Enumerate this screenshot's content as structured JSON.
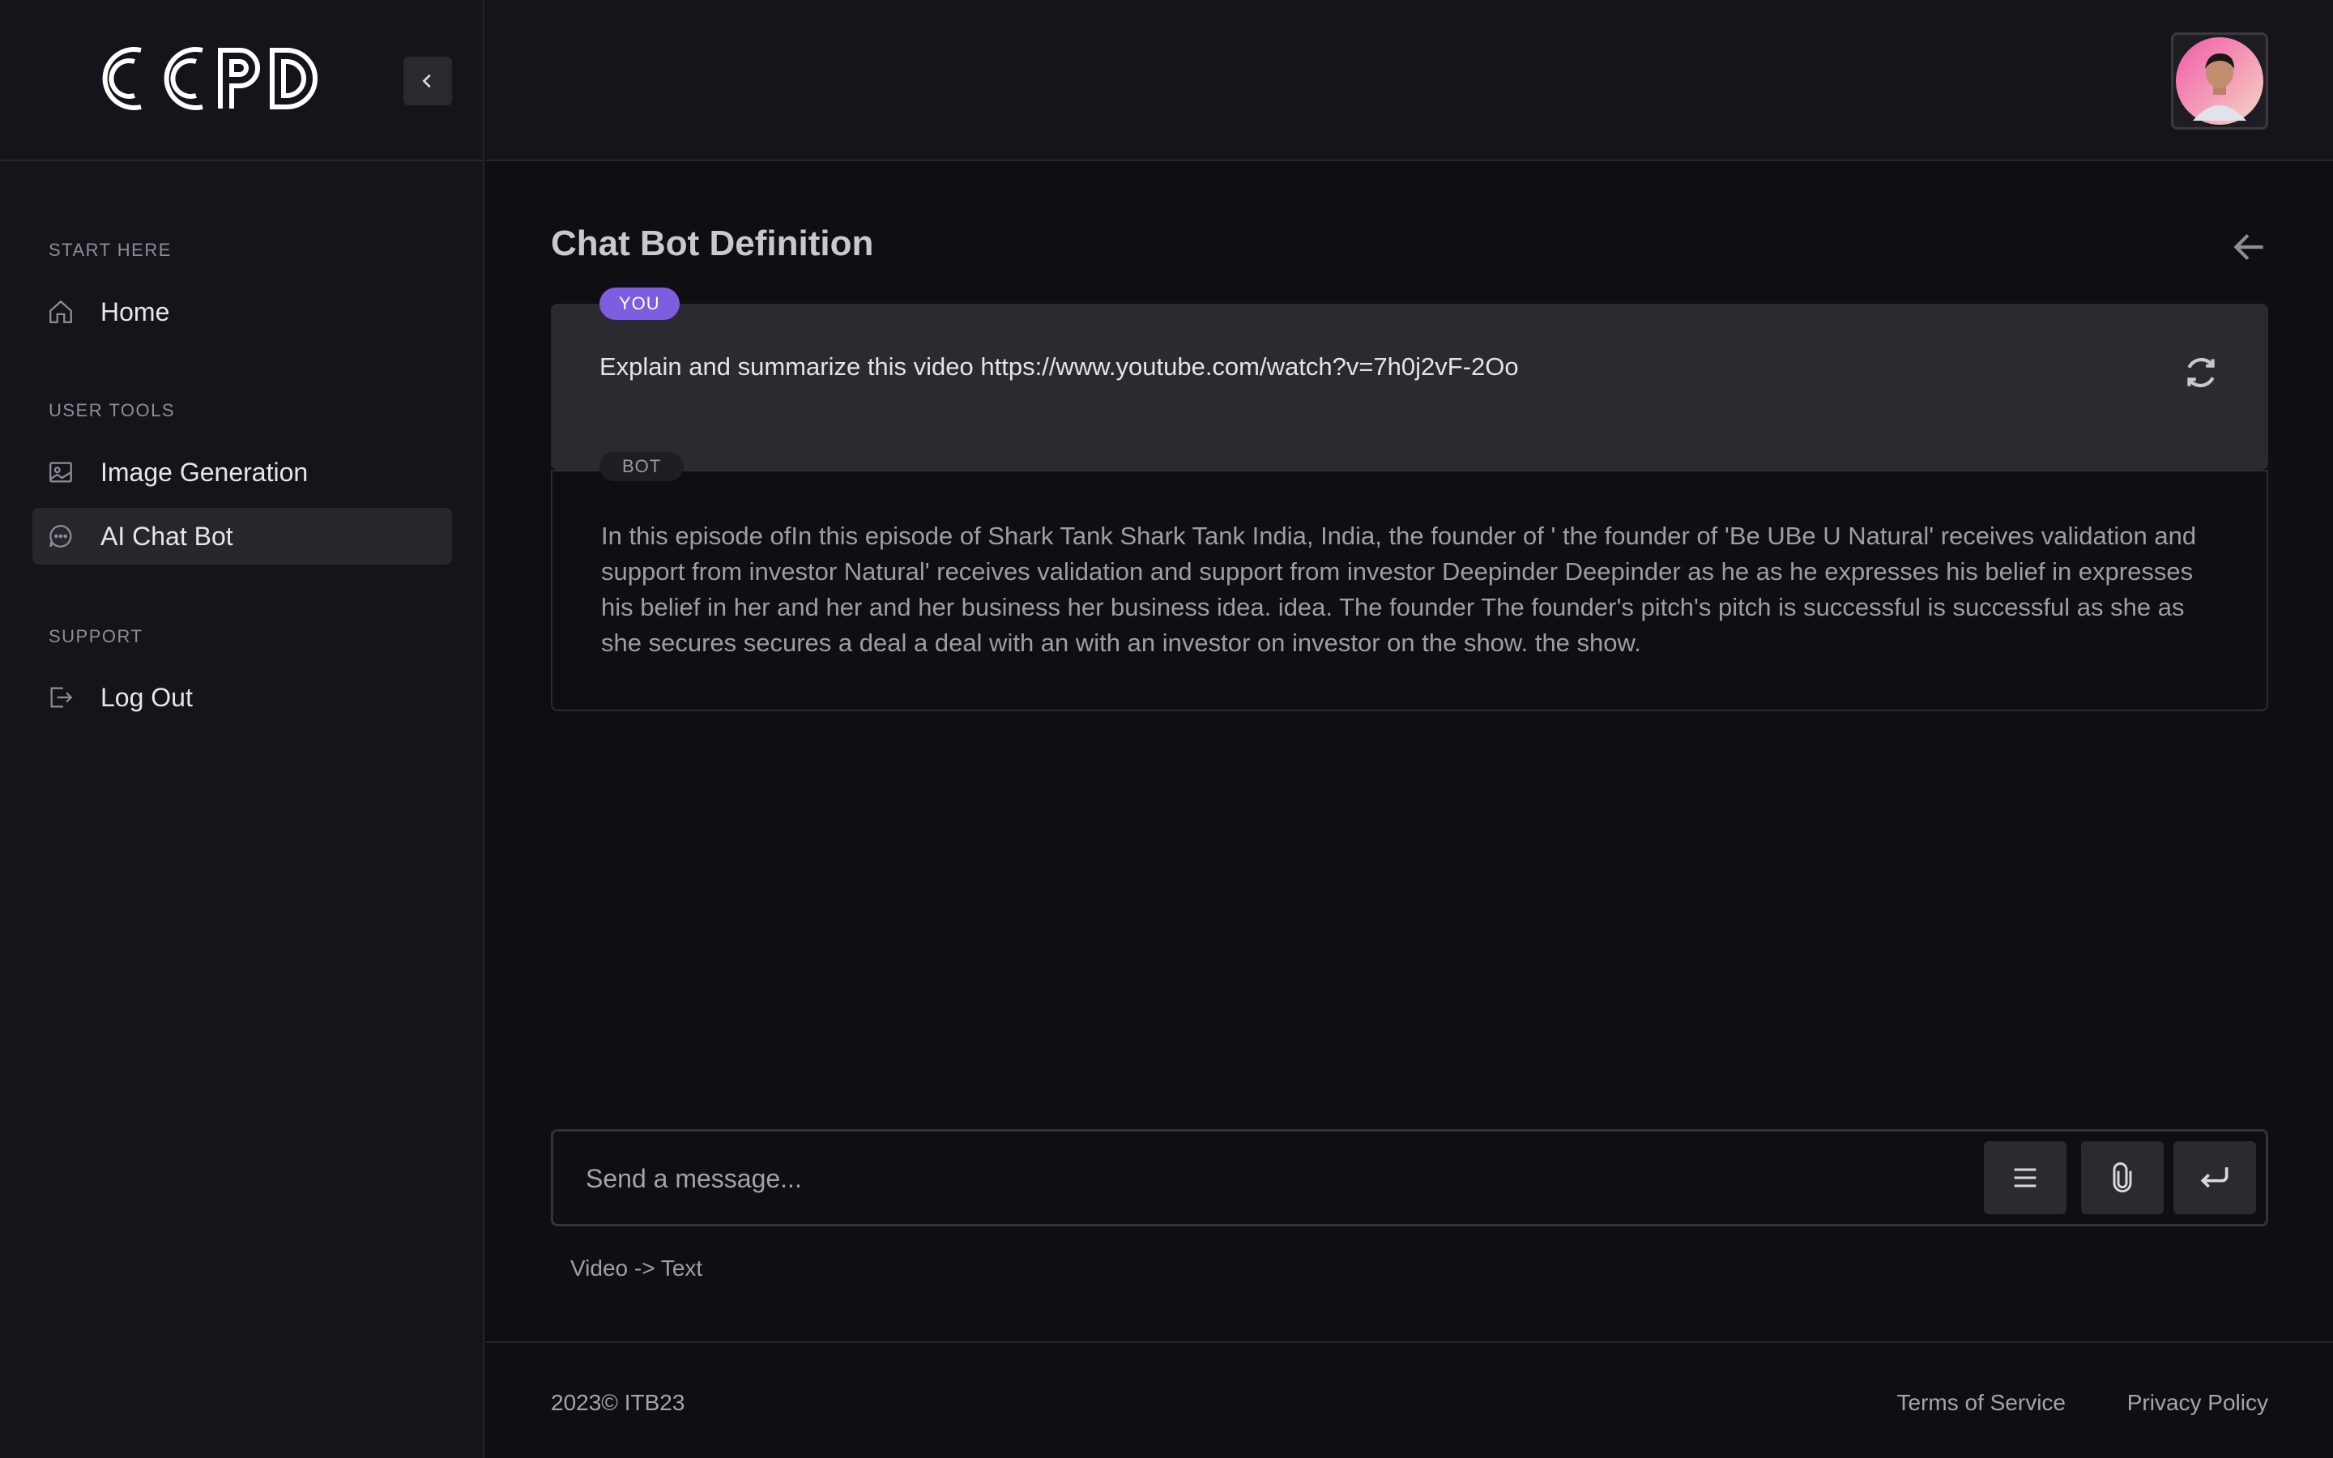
{
  "brand": {
    "logo_text": "CCPD"
  },
  "sidebar": {
    "sections": [
      {
        "title": "START HERE",
        "items": [
          {
            "label": "Home",
            "icon": "home-icon"
          }
        ]
      },
      {
        "title": "USER TOOLS",
        "items": [
          {
            "label": "Image Generation",
            "icon": "image-icon"
          },
          {
            "label": "AI Chat Bot",
            "icon": "chat-icon",
            "active": true
          }
        ]
      },
      {
        "title": "SUPPORT",
        "items": [
          {
            "label": "Log Out",
            "icon": "logout-icon"
          }
        ]
      }
    ]
  },
  "page": {
    "title": "Chat Bot Definition"
  },
  "chat": {
    "user_badge": "YOU",
    "user_message": "Explain and summarize this video https://www.youtube.com/watch?v=7h0j2vF-2Oo",
    "bot_badge": "BOT",
    "bot_message": "In this episode ofIn this episode of Shark Tank Shark Tank India, India, the founder of ' the founder of 'Be UBe U Natural' receives validation and support from investor Natural' receives validation and support from investor Deepinder Deepinder as he as he expresses his belief in expresses his belief in her and her and her business her business idea. idea. The founder The founder's pitch's pitch is successful is successful as she as she secures secures a deal a deal with an with an investor on investor on the show. the show."
  },
  "composer": {
    "placeholder": "Send a message...",
    "mode_hint": "Video -> Text"
  },
  "footer": {
    "copyright": "2023© ITB23",
    "terms": "Terms of Service",
    "privacy": "Privacy Policy"
  },
  "colors": {
    "accent": "#7c5ee0",
    "background": "#0f0e12",
    "sidebar": "#16141b"
  }
}
